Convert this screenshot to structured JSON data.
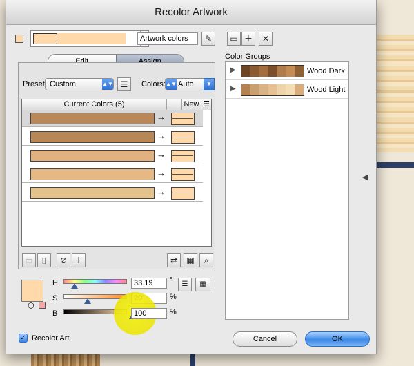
{
  "window": {
    "title": "Recolor Artwork"
  },
  "toolbar": {
    "name_field": "Artwork colors"
  },
  "tabs": {
    "edit": "Edit",
    "assign": "Assign"
  },
  "preset": {
    "label": "Preset:",
    "value": "Custom"
  },
  "colors_mode": {
    "label": "Colors:",
    "value": "Auto"
  },
  "table": {
    "current_header": "Current Colors (5)",
    "new_header": "New",
    "rows": [
      {
        "current": "#b8875a",
        "new": "#ffd9aa",
        "selected": true
      },
      {
        "current": "#b88756",
        "new": "#ffd9aa"
      },
      {
        "current": "#e1b27f",
        "new": "#ffd9aa"
      },
      {
        "current": "#e6b884",
        "new": "#ffd9aa"
      },
      {
        "current": "#e4c38a",
        "new": "#ffd9aa"
      }
    ]
  },
  "hsb": {
    "h_label": "H",
    "h_value": "33.19",
    "h_unit": "°",
    "s_label": "S",
    "s_value": "29",
    "s_unit": "%",
    "b_label": "B",
    "b_value": "100",
    "b_unit": "%",
    "h_level": 0.092,
    "s_level": 0.29,
    "b_level": 1.0,
    "swatch": "#ffd9aa"
  },
  "color_groups": {
    "title": "Color Groups",
    "items": [
      {
        "name": "Wood Dark",
        "swatches": [
          "#6d4524",
          "#8a5a30",
          "#a46d3d",
          "#7c4f2a",
          "#b07c49",
          "#c48b53",
          "#8e6033"
        ]
      },
      {
        "name": "Wood Light",
        "swatches": [
          "#b48150",
          "#caa070",
          "#d9b285",
          "#e6c193",
          "#efd3a9",
          "#f4dcb5",
          "#d7ad7c"
        ]
      }
    ]
  },
  "recolor_art": {
    "label": "Recolor Art",
    "checked": true
  },
  "buttons": {
    "cancel": "Cancel",
    "ok": "OK"
  },
  "current_strip": [
    "#ffd9aa",
    "#ffd9aa",
    "#ffd9aa",
    "#ffd9aa",
    "#ffd9aa"
  ]
}
